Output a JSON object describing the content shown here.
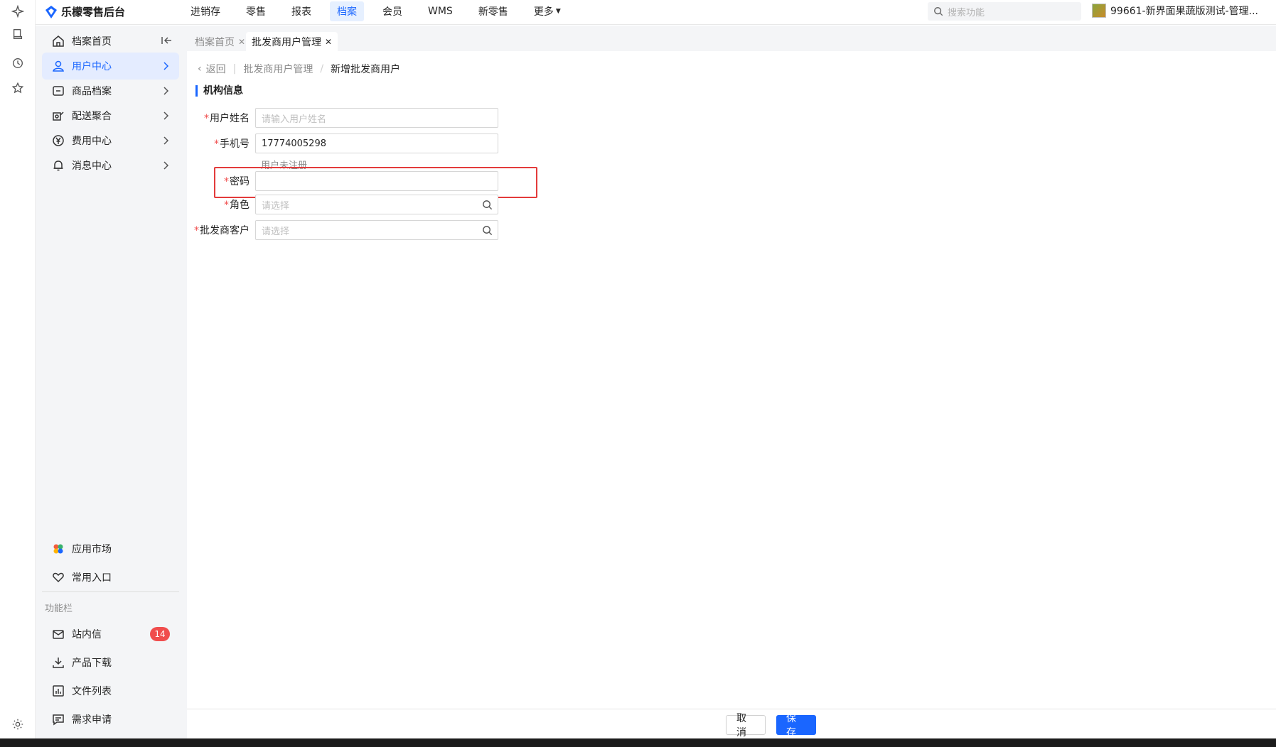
{
  "app": {
    "brand": "乐檬零售后台",
    "top_nav": [
      "进销存",
      "零售",
      "报表",
      "档案",
      "会员",
      "WMS",
      "新零售",
      "更多"
    ],
    "active_nav": "档案",
    "search_placeholder": "搜索功能",
    "account": "99661-新界面果蔬版测试-管理..."
  },
  "sidebar": {
    "home": "档案首页",
    "menu": [
      {
        "label": "用户中心",
        "active": true
      },
      {
        "label": "商品档案",
        "active": false
      },
      {
        "label": "配送聚合",
        "active": false
      },
      {
        "label": "费用中心",
        "active": false
      },
      {
        "label": "消息中心",
        "active": false
      }
    ],
    "bottom": [
      "应用市场",
      "常用入口"
    ],
    "section_label": "功能栏",
    "tools": [
      {
        "label": "站内信",
        "badge": "14"
      },
      {
        "label": "产品下载"
      },
      {
        "label": "文件列表"
      },
      {
        "label": "需求申请"
      }
    ]
  },
  "tabs": [
    {
      "label": "档案首页",
      "active": false
    },
    {
      "label": "批发商用户管理",
      "active": true
    }
  ],
  "breadcrumb": {
    "back": "返回",
    "parent": "批发商用户管理",
    "current": "新增批发商用户"
  },
  "form": {
    "section_title": "机构信息",
    "fields": [
      {
        "label": "用户姓名",
        "required": true,
        "value": "",
        "placeholder": "请输入用户姓名"
      },
      {
        "label": "手机号",
        "required": true,
        "value": "17774005298",
        "placeholder": ""
      },
      {
        "label": "密码",
        "required": true,
        "value": "",
        "placeholder": ""
      },
      {
        "label": "角色",
        "required": true,
        "value": "",
        "placeholder": "请选择"
      },
      {
        "label": "批发商客户",
        "required": true,
        "value": "",
        "placeholder": "请选择"
      }
    ],
    "phone_hint": "用户未注册"
  },
  "footer": {
    "cancel": "取消",
    "save": "保存"
  },
  "colors": {
    "accent": "#1a66ff",
    "required": "#f04d4d",
    "highlight": "#e33b3b"
  }
}
